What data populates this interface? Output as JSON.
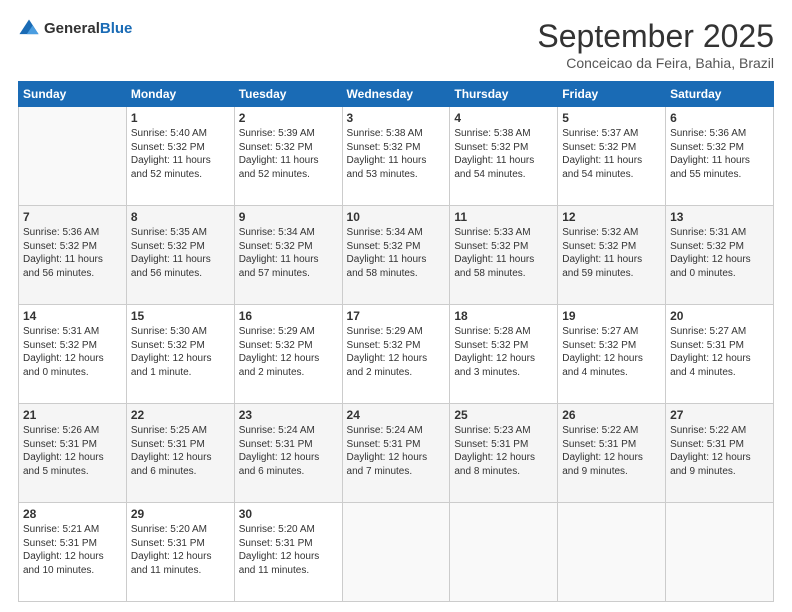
{
  "header": {
    "logo_general": "General",
    "logo_blue": "Blue",
    "month": "September 2025",
    "location": "Conceicao da Feira, Bahia, Brazil"
  },
  "days_of_week": [
    "Sunday",
    "Monday",
    "Tuesday",
    "Wednesday",
    "Thursday",
    "Friday",
    "Saturday"
  ],
  "weeks": [
    [
      {
        "day": "",
        "sunrise": "",
        "sunset": "",
        "daylight": ""
      },
      {
        "day": "1",
        "sunrise": "Sunrise: 5:40 AM",
        "sunset": "Sunset: 5:32 PM",
        "daylight": "Daylight: 11 hours and 52 minutes."
      },
      {
        "day": "2",
        "sunrise": "Sunrise: 5:39 AM",
        "sunset": "Sunset: 5:32 PM",
        "daylight": "Daylight: 11 hours and 52 minutes."
      },
      {
        "day": "3",
        "sunrise": "Sunrise: 5:38 AM",
        "sunset": "Sunset: 5:32 PM",
        "daylight": "Daylight: 11 hours and 53 minutes."
      },
      {
        "day": "4",
        "sunrise": "Sunrise: 5:38 AM",
        "sunset": "Sunset: 5:32 PM",
        "daylight": "Daylight: 11 hours and 54 minutes."
      },
      {
        "day": "5",
        "sunrise": "Sunrise: 5:37 AM",
        "sunset": "Sunset: 5:32 PM",
        "daylight": "Daylight: 11 hours and 54 minutes."
      },
      {
        "day": "6",
        "sunrise": "Sunrise: 5:36 AM",
        "sunset": "Sunset: 5:32 PM",
        "daylight": "Daylight: 11 hours and 55 minutes."
      }
    ],
    [
      {
        "day": "7",
        "sunrise": "Sunrise: 5:36 AM",
        "sunset": "Sunset: 5:32 PM",
        "daylight": "Daylight: 11 hours and 56 minutes."
      },
      {
        "day": "8",
        "sunrise": "Sunrise: 5:35 AM",
        "sunset": "Sunset: 5:32 PM",
        "daylight": "Daylight: 11 hours and 56 minutes."
      },
      {
        "day": "9",
        "sunrise": "Sunrise: 5:34 AM",
        "sunset": "Sunset: 5:32 PM",
        "daylight": "Daylight: 11 hours and 57 minutes."
      },
      {
        "day": "10",
        "sunrise": "Sunrise: 5:34 AM",
        "sunset": "Sunset: 5:32 PM",
        "daylight": "Daylight: 11 hours and 58 minutes."
      },
      {
        "day": "11",
        "sunrise": "Sunrise: 5:33 AM",
        "sunset": "Sunset: 5:32 PM",
        "daylight": "Daylight: 11 hours and 58 minutes."
      },
      {
        "day": "12",
        "sunrise": "Sunrise: 5:32 AM",
        "sunset": "Sunset: 5:32 PM",
        "daylight": "Daylight: 11 hours and 59 minutes."
      },
      {
        "day": "13",
        "sunrise": "Sunrise: 5:31 AM",
        "sunset": "Sunset: 5:32 PM",
        "daylight": "Daylight: 12 hours and 0 minutes."
      }
    ],
    [
      {
        "day": "14",
        "sunrise": "Sunrise: 5:31 AM",
        "sunset": "Sunset: 5:32 PM",
        "daylight": "Daylight: 12 hours and 0 minutes."
      },
      {
        "day": "15",
        "sunrise": "Sunrise: 5:30 AM",
        "sunset": "Sunset: 5:32 PM",
        "daylight": "Daylight: 12 hours and 1 minute."
      },
      {
        "day": "16",
        "sunrise": "Sunrise: 5:29 AM",
        "sunset": "Sunset: 5:32 PM",
        "daylight": "Daylight: 12 hours and 2 minutes."
      },
      {
        "day": "17",
        "sunrise": "Sunrise: 5:29 AM",
        "sunset": "Sunset: 5:32 PM",
        "daylight": "Daylight: 12 hours and 2 minutes."
      },
      {
        "day": "18",
        "sunrise": "Sunrise: 5:28 AM",
        "sunset": "Sunset: 5:32 PM",
        "daylight": "Daylight: 12 hours and 3 minutes."
      },
      {
        "day": "19",
        "sunrise": "Sunrise: 5:27 AM",
        "sunset": "Sunset: 5:32 PM",
        "daylight": "Daylight: 12 hours and 4 minutes."
      },
      {
        "day": "20",
        "sunrise": "Sunrise: 5:27 AM",
        "sunset": "Sunset: 5:31 PM",
        "daylight": "Daylight: 12 hours and 4 minutes."
      }
    ],
    [
      {
        "day": "21",
        "sunrise": "Sunrise: 5:26 AM",
        "sunset": "Sunset: 5:31 PM",
        "daylight": "Daylight: 12 hours and 5 minutes."
      },
      {
        "day": "22",
        "sunrise": "Sunrise: 5:25 AM",
        "sunset": "Sunset: 5:31 PM",
        "daylight": "Daylight: 12 hours and 6 minutes."
      },
      {
        "day": "23",
        "sunrise": "Sunrise: 5:24 AM",
        "sunset": "Sunset: 5:31 PM",
        "daylight": "Daylight: 12 hours and 6 minutes."
      },
      {
        "day": "24",
        "sunrise": "Sunrise: 5:24 AM",
        "sunset": "Sunset: 5:31 PM",
        "daylight": "Daylight: 12 hours and 7 minutes."
      },
      {
        "day": "25",
        "sunrise": "Sunrise: 5:23 AM",
        "sunset": "Sunset: 5:31 PM",
        "daylight": "Daylight: 12 hours and 8 minutes."
      },
      {
        "day": "26",
        "sunrise": "Sunrise: 5:22 AM",
        "sunset": "Sunset: 5:31 PM",
        "daylight": "Daylight: 12 hours and 9 minutes."
      },
      {
        "day": "27",
        "sunrise": "Sunrise: 5:22 AM",
        "sunset": "Sunset: 5:31 PM",
        "daylight": "Daylight: 12 hours and 9 minutes."
      }
    ],
    [
      {
        "day": "28",
        "sunrise": "Sunrise: 5:21 AM",
        "sunset": "Sunset: 5:31 PM",
        "daylight": "Daylight: 12 hours and 10 minutes."
      },
      {
        "day": "29",
        "sunrise": "Sunrise: 5:20 AM",
        "sunset": "Sunset: 5:31 PM",
        "daylight": "Daylight: 12 hours and 11 minutes."
      },
      {
        "day": "30",
        "sunrise": "Sunrise: 5:20 AM",
        "sunset": "Sunset: 5:31 PM",
        "daylight": "Daylight: 12 hours and 11 minutes."
      },
      {
        "day": "",
        "sunrise": "",
        "sunset": "",
        "daylight": ""
      },
      {
        "day": "",
        "sunrise": "",
        "sunset": "",
        "daylight": ""
      },
      {
        "day": "",
        "sunrise": "",
        "sunset": "",
        "daylight": ""
      },
      {
        "day": "",
        "sunrise": "",
        "sunset": "",
        "daylight": ""
      }
    ]
  ]
}
